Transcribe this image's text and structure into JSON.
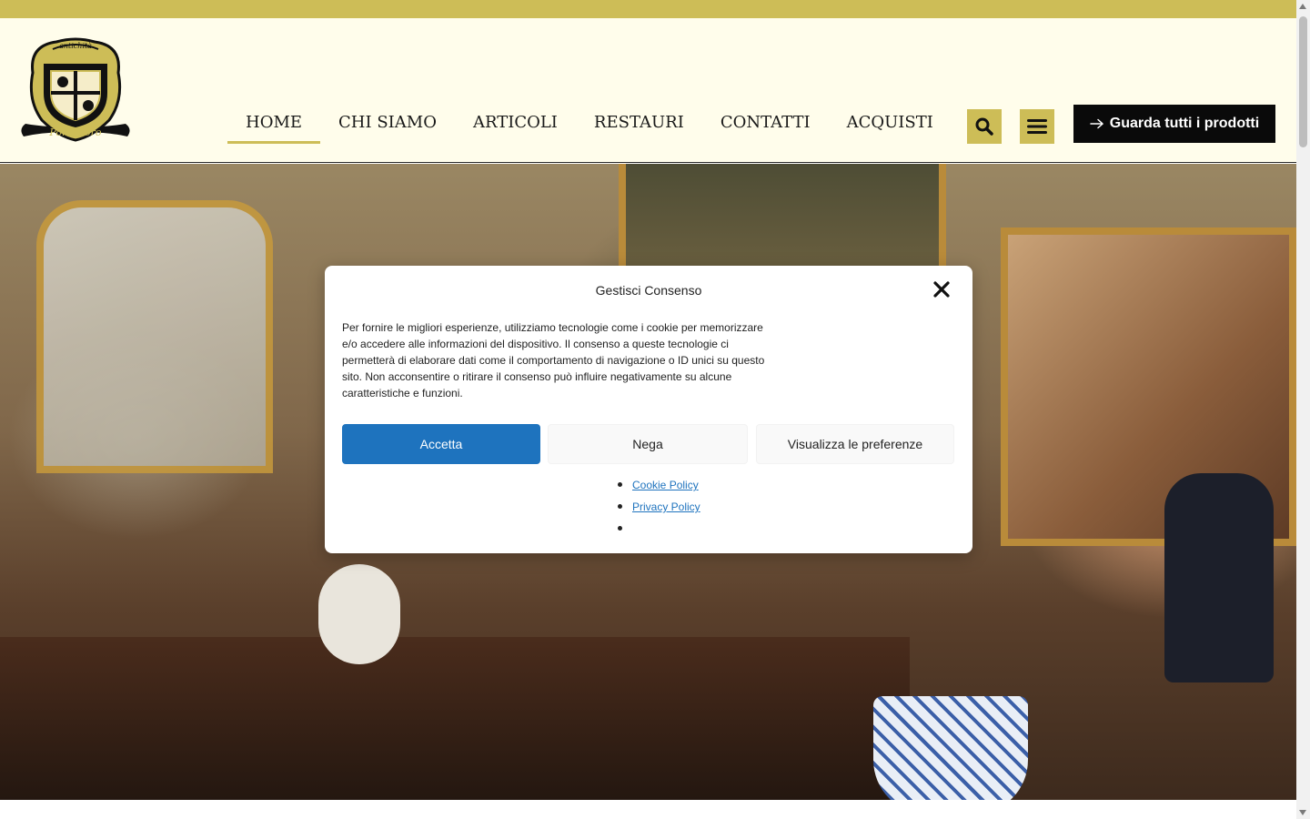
{
  "brand": {
    "logo_icon": "crest-logo",
    "logo_top_text": "antichità",
    "logo_bottom_text": "Pontedoro",
    "accent_color": "#cdbd57",
    "header_bg": "#fffdeb"
  },
  "nav": {
    "items": [
      {
        "label": "HOME",
        "active": true
      },
      {
        "label": "CHI SIAMO",
        "active": false
      },
      {
        "label": "ARTICOLI",
        "active": false
      },
      {
        "label": "RESTAURI",
        "active": false
      },
      {
        "label": "CONTATTI",
        "active": false
      },
      {
        "label": "ACQUISTI",
        "active": false
      }
    ]
  },
  "header": {
    "search_icon": "search-icon",
    "menu_icon": "hamburger-menu-icon",
    "cta_icon": "arrow-right-icon",
    "cta_label": "Guarda tutti i prodotti",
    "cta_color": "#0a0a0a"
  },
  "hero": {
    "image": "antique-shop-interior-photo"
  },
  "consent": {
    "title": "Gestisci Consenso",
    "close_icon": "close-icon",
    "text": "Per fornire le migliori esperienze, utilizziamo tecnologie come i cookie per memorizzare e/o accedere alle informazioni del dispositivo. Il consenso a queste tecnologie ci permetterà di elaborare dati come il comportamento di navigazione o ID unici su questo sito. Non acconsentire o ritirare il consenso può influire negativamente su alcune caratteristiche e funzioni.",
    "accept_label": "Accetta",
    "deny_label": "Nega",
    "prefs_label": "Visualizza le preferenze",
    "accept_color": "#1e73be",
    "links": [
      "Cookie Policy",
      "Privacy Policy",
      ""
    ]
  }
}
